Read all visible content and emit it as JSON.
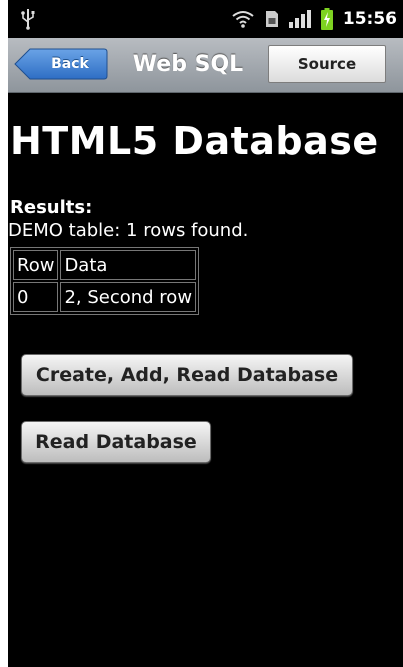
{
  "status_bar": {
    "time": "15:56",
    "icons": [
      "usb-icon",
      "wifi-icon",
      "sim-icon",
      "signal-icon",
      "battery-charging-icon"
    ],
    "battery_color": "#7ed321"
  },
  "title_bar": {
    "back_label": "Back",
    "title": "Web SQL",
    "source_label": "Source",
    "back_color": "#3b7fd0"
  },
  "content": {
    "heading": "HTML5 Database",
    "results_label": "Results:",
    "results_message": "DEMO table: 1 rows found.",
    "table": {
      "headers": [
        "Row",
        "Data"
      ],
      "rows": [
        [
          "0",
          "2, Second row"
        ]
      ]
    },
    "buttons": {
      "create_label": "Create, Add, Read Database",
      "read_label": "Read Database"
    }
  }
}
